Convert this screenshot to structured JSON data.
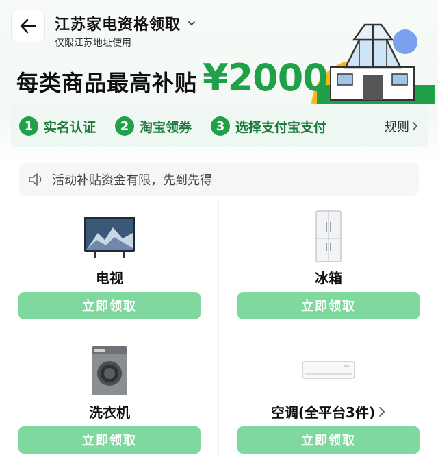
{
  "header": {
    "title": "江苏家电资格领取",
    "subtitle": "仅限江苏地址使用"
  },
  "banner": {
    "headline": "每类商品最高补贴",
    "amount": "¥2000"
  },
  "steps": [
    {
      "num": "1",
      "label": "实名认证"
    },
    {
      "num": "2",
      "label": "淘宝领券"
    },
    {
      "num": "3",
      "label": "选择支付宝支付"
    }
  ],
  "rules_label": "规则",
  "notice": "活动补贴资金有限，先到先得",
  "products": [
    {
      "name": "电视",
      "button": "立即领取",
      "icon": "tv-icon"
    },
    {
      "name": "冰箱",
      "button": "立即领取",
      "icon": "fridge-icon"
    },
    {
      "name": "洗衣机",
      "button": "立即领取",
      "icon": "washer-icon"
    },
    {
      "name": "空调(全平台3件)",
      "button": "立即领取",
      "icon": "air-conditioner-icon"
    }
  ],
  "colors": {
    "accent": "#21a04a",
    "button": "#7fd89e"
  }
}
